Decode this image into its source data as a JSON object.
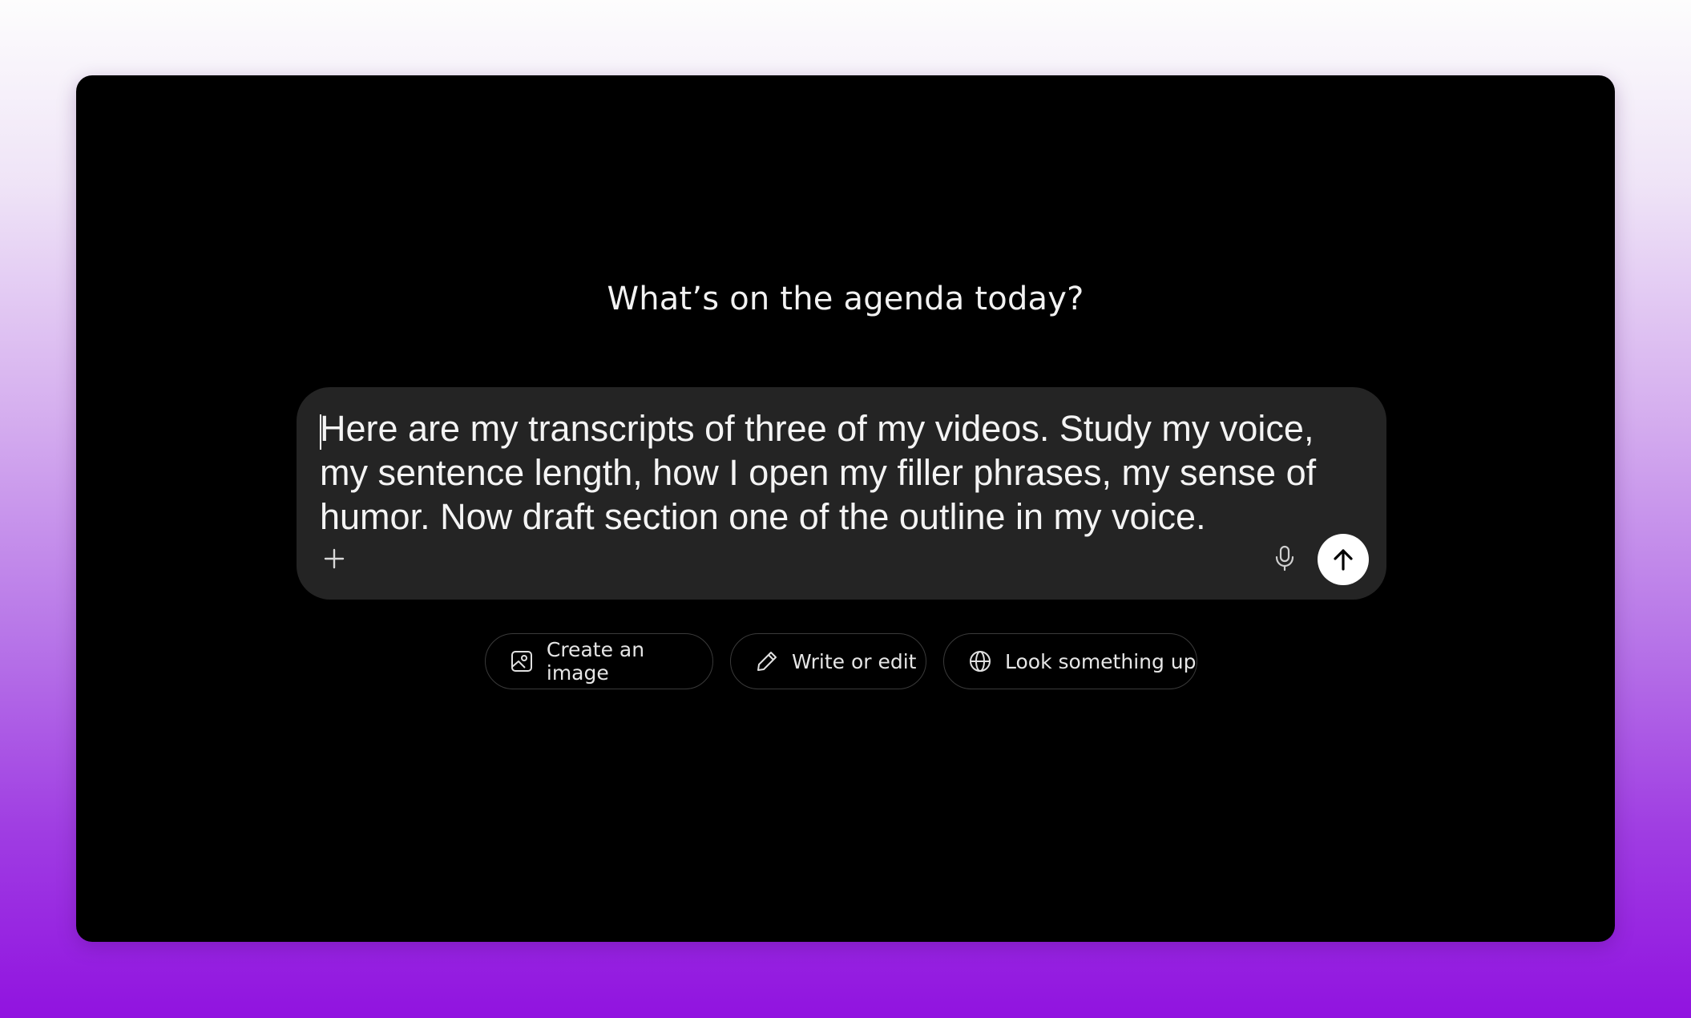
{
  "main": {
    "headline": "What’s on the agenda today?"
  },
  "composer": {
    "text": "Here are my transcripts of three of my videos. Study my voice,\nmy sentence length, how I open my filler phrases, my sense of\nhumor. Now draft section one of the outline in my voice.",
    "add_icon": "plus-icon",
    "mic_icon": "microphone-icon",
    "send_icon": "arrow-up-icon"
  },
  "suggestions": [
    {
      "label": "Create an image",
      "icon": "image-icon"
    },
    {
      "label": "Write or edit",
      "icon": "pencil-icon"
    },
    {
      "label": "Look something up",
      "icon": "globe-icon"
    }
  ],
  "colors": {
    "window_background": "#000000",
    "composer_background": "#242424",
    "send_button": "#ffffff",
    "page_gradient_top": "#fdfdfd",
    "page_gradient_bottom": "#9113e0"
  }
}
